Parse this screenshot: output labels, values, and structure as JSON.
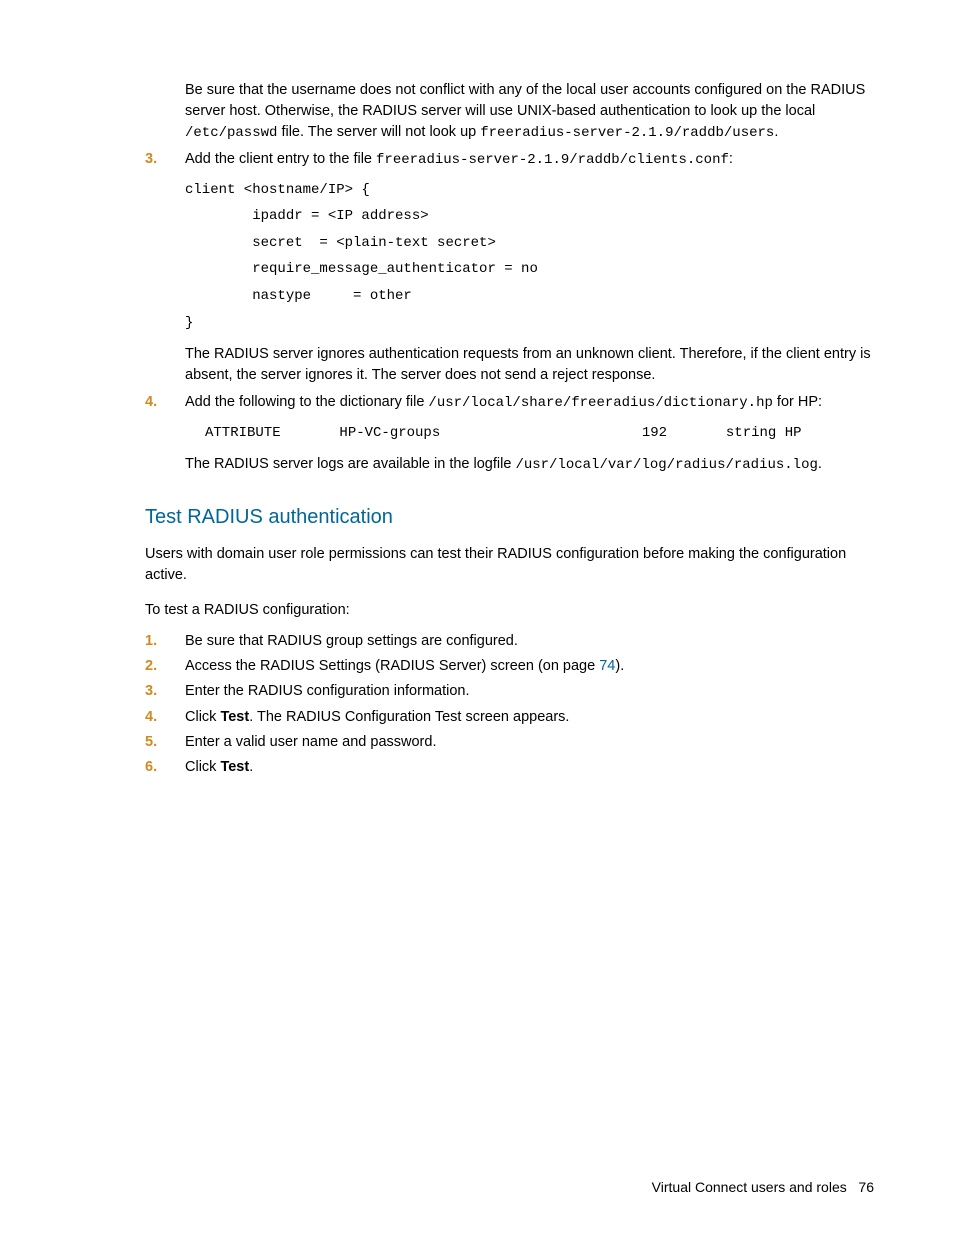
{
  "intro": {
    "p1_a": "Be sure that the username does not conflict with any of the local user accounts configured on the RADIUS server host. Otherwise, the RADIUS server will use UNIX-based authentication to look up the local ",
    "p1_code1": "/etc/passwd",
    "p1_b": " file. The server will not look up ",
    "p1_code2": "freeradius-server-2.1.9/raddb/users",
    "p1_c": "."
  },
  "step3": {
    "num": "3.",
    "lead_a": "Add the client entry to the file ",
    "lead_code": "freeradius-server-2.1.9/raddb/clients.conf",
    "lead_b": ":",
    "code": "client <hostname/IP> {\n        ipaddr = <IP address>\n        secret  = <plain-text secret>\n        require_message_authenticator = no\n        nastype     = other\n}",
    "after": "The RADIUS server ignores authentication requests from an unknown client. Therefore, if the client entry is absent, the server ignores it. The server does not send a reject response."
  },
  "step4": {
    "num": "4.",
    "lead_a": "Add the following to the dictionary file ",
    "lead_code": "/usr/local/share/freeradius/dictionary.hp",
    "lead_b": " for HP:",
    "code": "ATTRIBUTE       HP-VC-groups                        192       string HP",
    "after_a": "The RADIUS server logs are available in the logfile ",
    "after_code": "/usr/local/var/log/radius/radius.log",
    "after_b": "."
  },
  "section": {
    "heading": "Test RADIUS authentication",
    "p1": "Users with domain user role permissions can test their RADIUS configuration before making the configuration active.",
    "p2": "To test a RADIUS configuration:"
  },
  "steps": [
    {
      "num": "1.",
      "text_a": "Be sure that RADIUS group settings are configured."
    },
    {
      "num": "2.",
      "text_a": "Access the RADIUS Settings (RADIUS Server) screen (on page ",
      "link": "74",
      "text_b": ")."
    },
    {
      "num": "3.",
      "text_a": "Enter the RADIUS configuration information."
    },
    {
      "num": "4.",
      "text_a": "Click ",
      "bold": "Test",
      "text_b": ". The RADIUS Configuration Test screen appears."
    },
    {
      "num": "5.",
      "text_a": "Enter a valid user name and password."
    },
    {
      "num": "6.",
      "text_a": "Click ",
      "bold": "Test",
      "text_b": "."
    }
  ],
  "footer": {
    "label": "Virtual Connect users and roles",
    "page": "76"
  }
}
